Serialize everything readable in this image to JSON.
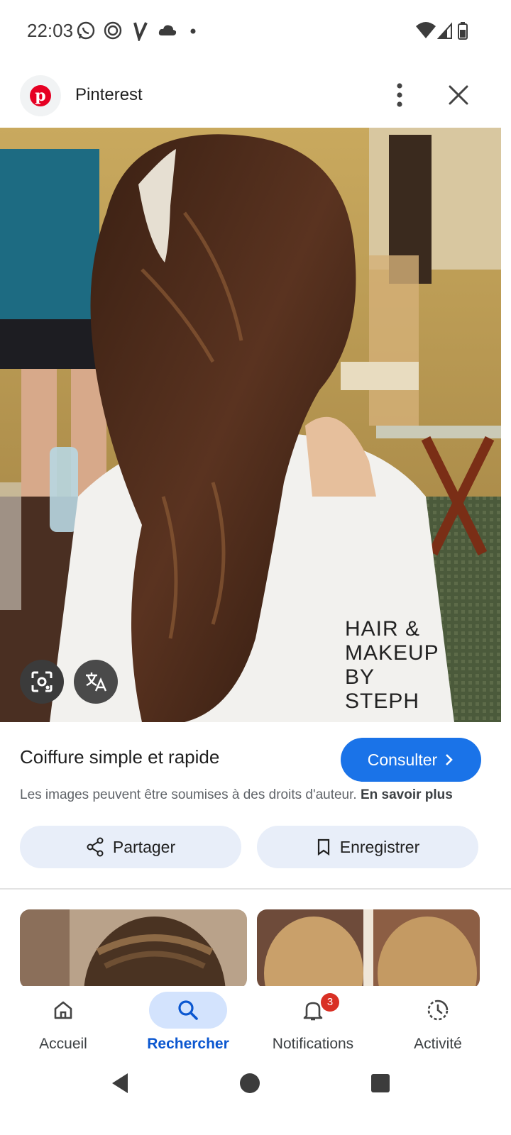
{
  "status_bar": {
    "time": "22:03",
    "icons": [
      "whatsapp-icon",
      "signal-app-icon",
      "v-app-icon",
      "cloud-icon",
      "dot-icon"
    ],
    "system_icons": [
      "wifi-icon",
      "cellular-icon",
      "battery-icon"
    ]
  },
  "source": {
    "name": "Pinterest",
    "logo_letter": "p"
  },
  "image": {
    "watermark": "HAIR & MAKEUP BY STEPH"
  },
  "result": {
    "title": "Coiffure simple et rapide",
    "consult_label": "Consulter",
    "copyright_text": "Les images peuvent être soumises à des droits d'auteur.",
    "learn_more": "En savoir plus",
    "share_label": "Partager",
    "save_label": "Enregistrer"
  },
  "bottom_nav": {
    "items": [
      {
        "label": "Accueil",
        "icon": "home-icon",
        "active": false
      },
      {
        "label": "Rechercher",
        "icon": "search-icon",
        "active": true
      },
      {
        "label": "Notifications",
        "icon": "bell-icon",
        "active": false,
        "badge": "3"
      },
      {
        "label": "Activité",
        "icon": "activity-icon",
        "active": false
      }
    ]
  },
  "colors": {
    "accent": "#1a73e8",
    "active_nav": "#0b57d0",
    "pill_bg": "#d3e3fd",
    "action_bg": "#e8eef9",
    "badge": "#d93025",
    "pinterest": "#e60023"
  }
}
